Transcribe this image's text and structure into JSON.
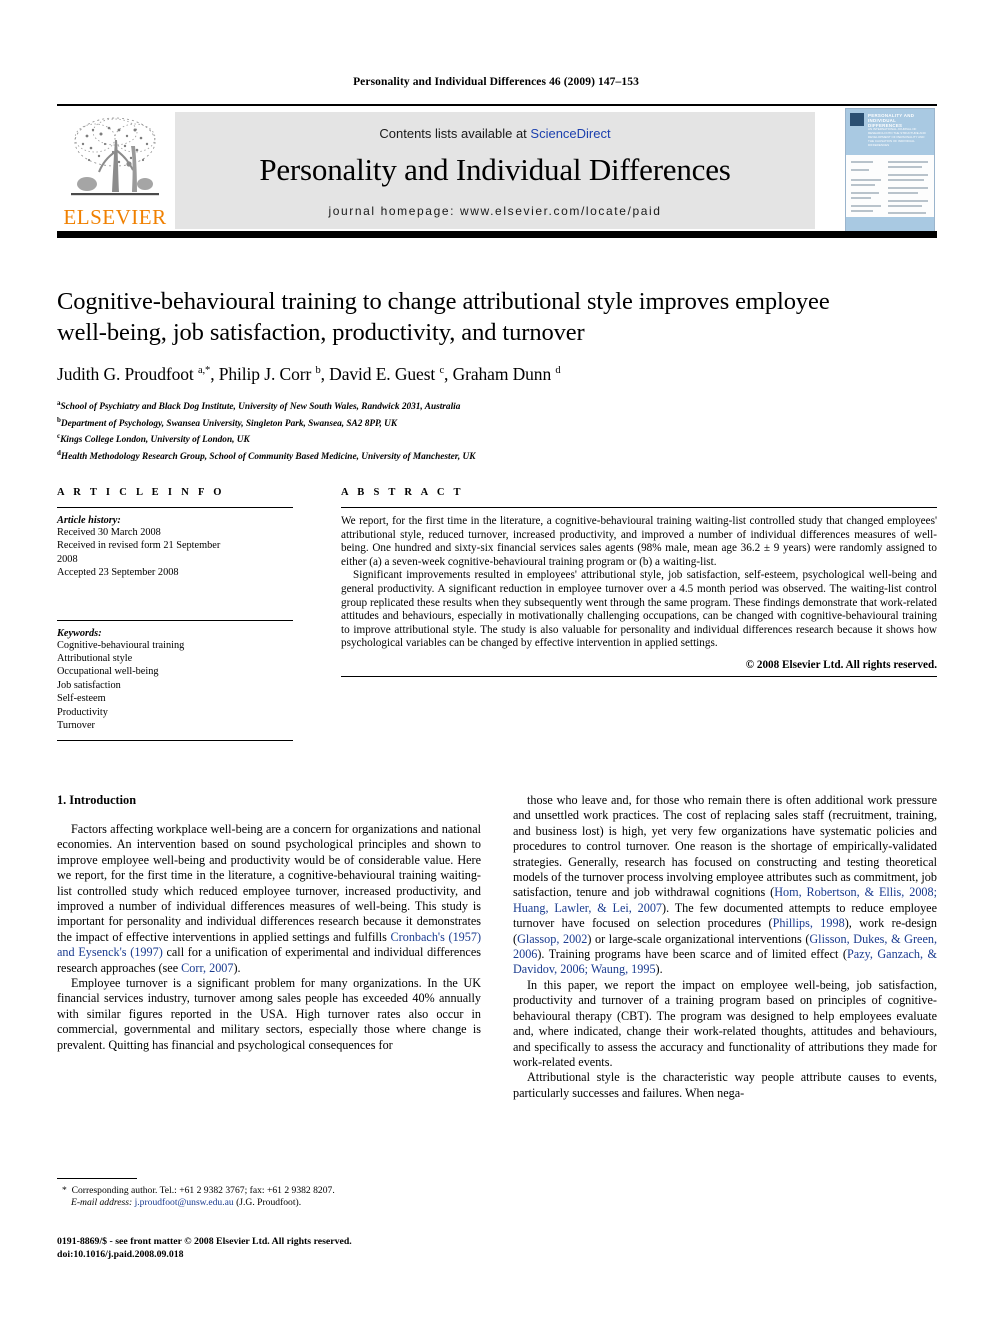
{
  "running_head": "Personality and Individual Differences 46 (2009) 147–153",
  "masthead": {
    "publisher_name": "ELSEVIER",
    "contents_prefix": "Contents lists available at ",
    "sciencedirect_label": "ScienceDirect",
    "journal_title": "Personality and Individual Differences",
    "homepage_line": "journal homepage: www.elsevier.com/locate/paid",
    "cover": {
      "title": "PERSONALITY AND INDIVIDUAL DIFFERENCES",
      "subtitle": "AN INTERNATIONAL JOURNAL OF RESEARCH INTO THE STRUCTURE AND DEVELOPMENT OF PERSONALITY AND THE CAUSATION OF INDIVIDUAL DIFFERENCES",
      "accent_color": "#a9c9e2"
    },
    "link_color": "#1b3fae",
    "brand_color": "#F08000"
  },
  "article": {
    "title": "Cognitive-behavioural training to change attributional style improves employee well-being, job satisfaction, productivity, and turnover",
    "authors_html": "Judith G. Proudfoot <sup>a,*</sup>, Philip J. Corr <sup>b</sup>, David E. Guest <sup>c</sup>, Graham Dunn <sup>d</sup>",
    "affiliations": [
      {
        "marker": "a",
        "text": "School of Psychiatry and Black Dog Institute, University of New South Wales, Randwick 2031, Australia"
      },
      {
        "marker": "b",
        "text": "Department of Psychology, Swansea University, Singleton Park, Swansea, SA2 8PP, UK"
      },
      {
        "marker": "c",
        "text": "Kings College London, University of London, UK"
      },
      {
        "marker": "d",
        "text": "Health Methodology Research Group, School of Community Based Medicine, University of Manchester, UK"
      }
    ]
  },
  "article_info": {
    "heading": "A R T I C L E   I N F O",
    "history_label": "Article history:",
    "history": [
      "Received 30 March 2008",
      "Received in revised form 21 September",
      "2008",
      "Accepted 23 September 2008"
    ],
    "keywords_label": "Keywords:",
    "keywords": [
      "Cognitive-behavioural training",
      "Attributional style",
      "Occupational well-being",
      "Job satisfaction",
      "Self-esteem",
      "Productivity",
      "Turnover"
    ]
  },
  "abstract": {
    "heading": "A B S T R A C T",
    "paragraphs": [
      "We report, for the first time in the literature, a cognitive-behavioural training waiting-list controlled study that changed employees' attributional style, reduced turnover, increased productivity, and improved a number of individual differences measures of well-being. One hundred and sixty-six financial services sales agents (98% male, mean age 36.2 ± 9 years) were randomly assigned to either (a) a seven-week cognitive-behavioural training program or (b) a waiting-list.",
      "Significant improvements resulted in employees' attributional style, job satisfaction, self-esteem, psychological well-being and general productivity. A significant reduction in employee turnover over a 4.5 month period was observed. The waiting-list control group replicated these results when they subsequently went through the same program. These findings demonstrate that work-related attitudes and behaviours, especially in motivationally challenging occupations, can be changed with cognitive-behavioural training to improve attributional style. The study is also valuable for personality and individual differences research because it shows how psychological variables can be changed by effective intervention in applied settings."
    ],
    "copyright": "© 2008 Elsevier Ltd. All rights reserved."
  },
  "section": {
    "number_title": "1. Introduction"
  },
  "body": {
    "left_paragraphs": [
      "Factors affecting workplace well-being are a concern for organizations and national economies. An intervention based on sound psychological principles and shown to improve employee well-being and productivity would be of considerable value. Here we report, for the first time in the literature, a cognitive-behavioural training waiting-list controlled study which reduced employee turnover, increased productivity, and improved a number of individual differences measures of well-being. This study is important for personality and individual differences research because it demonstrates the impact of effective interventions in applied settings and fulfills Cronbach's (1957) and Eysenck's (1997) call for a unification of experimental and individual differences research approaches (see Corr, 2007).",
      "Employee turnover is a significant problem for many organizations. In the UK financial services industry, turnover among sales people has exceeded 40% annually with similar figures reported in the USA. High turnover rates also occur in commercial, governmental and military sectors, especially those where change is prevalent. Quitting has financial and psychological consequences for"
    ],
    "right_paragraphs": [
      "those who leave and, for those who remain there is often additional work pressure and unsettled work practices. The cost of replacing sales staff (recruitment, training, and business lost) is high, yet very few organizations have systematic policies and procedures to control turnover. One reason is the shortage of empirically-validated strategies. Generally, research has focused on constructing and testing theoretical models of the turnover process involving employee attributes such as commitment, job satisfaction, tenure and job withdrawal cognitions (Hom, Robertson, & Ellis, 2008; Huang, Lawler, & Lei, 2007). The few documented attempts to reduce employee turnover have focused on selection procedures (Phillips, 1998), work re-design (Glassop, 2002) or large-scale organizational interventions (Glisson, Dukes, & Green, 2006). Training programs have been scarce and of limited effect (Pazy, Ganzach, & Davidov, 2006; Waung, 1995).",
      "In this paper, we report the impact on employee well-being, job satisfaction, productivity and turnover of a training program based on principles of cognitive-behavioural therapy (CBT). The program was designed to help employees evaluate and, where indicated, change their work-related thoughts, attitudes and behaviours, and specifically to assess the accuracy and functionality of attributions they made for work-related events.",
      "Attributional style is the characteristic way people attribute causes to events, particularly successes and failures. When nega-"
    ],
    "citation_color": "#1a3b8f"
  },
  "footnote": {
    "corresponding": "Corresponding author. Tel.: +61 2 9382 3767; fax: +61 2 9382 8207.",
    "email_label": "E-mail address:",
    "email": "j.proudfoot@unsw.edu.au",
    "email_owner": "(J.G. Proudfoot)."
  },
  "imprint": {
    "line1": "0191-8869/$ - see front matter © 2008 Elsevier Ltd. All rights reserved.",
    "line2": "doi:10.1016/j.paid.2008.09.018"
  }
}
